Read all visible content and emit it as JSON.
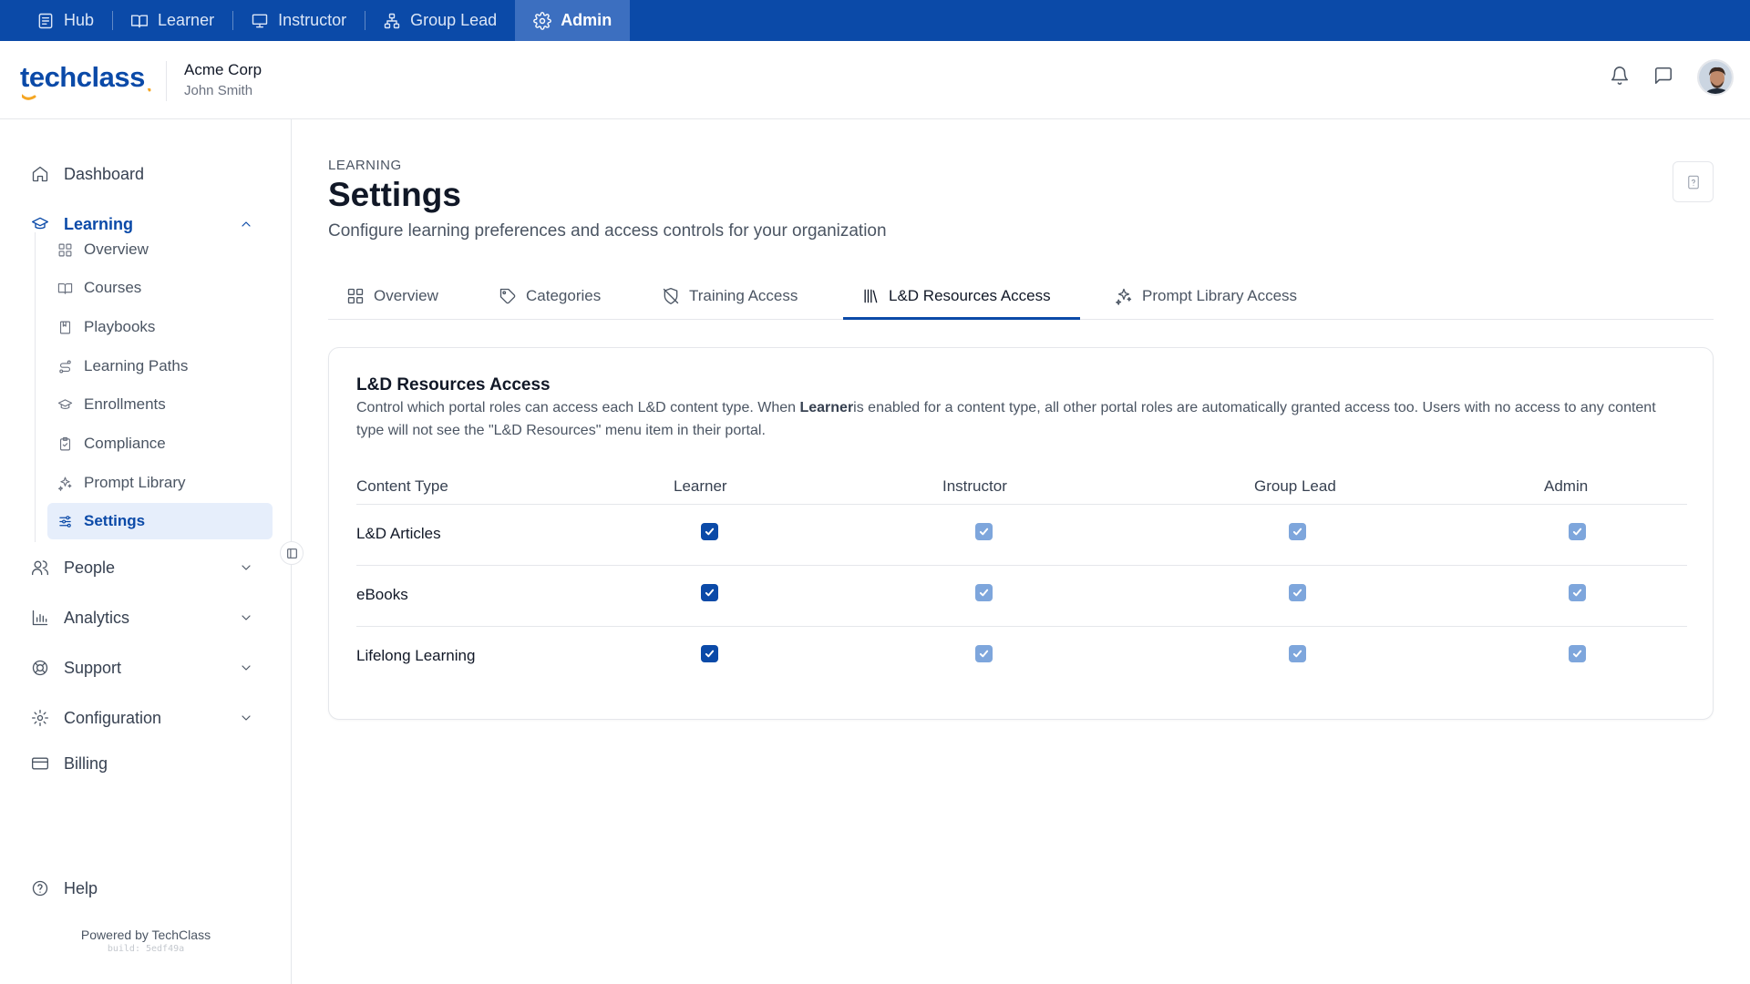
{
  "roles": [
    {
      "label": "Hub",
      "icon": "hub-icon"
    },
    {
      "label": "Learner",
      "icon": "book-open-icon"
    },
    {
      "label": "Instructor",
      "icon": "presentation-icon"
    },
    {
      "label": "Group Lead",
      "icon": "org-chart-icon"
    },
    {
      "label": "Admin",
      "icon": "gear-icon",
      "active": true
    }
  ],
  "header": {
    "logo": "techclass",
    "org_name": "Acme Corp",
    "user_name": "John Smith"
  },
  "sidebar": {
    "items": [
      {
        "label": "Dashboard",
        "icon": "home-icon"
      },
      {
        "label": "Learning",
        "icon": "graduation-cap-icon",
        "expanded": true
      },
      {
        "label": "People",
        "icon": "users-icon"
      },
      {
        "label": "Analytics",
        "icon": "bar-chart-icon"
      },
      {
        "label": "Support",
        "icon": "lifebuoy-icon"
      },
      {
        "label": "Configuration",
        "icon": "gear-icon"
      },
      {
        "label": "Billing",
        "icon": "credit-card-icon"
      }
    ],
    "learning_sub": [
      {
        "label": "Overview",
        "icon": "grid-icon"
      },
      {
        "label": "Courses",
        "icon": "book-open-icon"
      },
      {
        "label": "Playbooks",
        "icon": "bookmark-icon"
      },
      {
        "label": "Learning Paths",
        "icon": "route-icon"
      },
      {
        "label": "Enrollments",
        "icon": "graduation-cap-icon"
      },
      {
        "label": "Compliance",
        "icon": "clipboard-check-icon"
      },
      {
        "label": "Prompt Library",
        "icon": "sparkles-icon"
      },
      {
        "label": "Settings",
        "icon": "sliders-icon",
        "active": true
      }
    ],
    "help": "Help",
    "powered_by": "Powered by TechClass",
    "build": "build: 5edf49a"
  },
  "page": {
    "breadcrumb": "LEARNING",
    "title": "Settings",
    "subtitle": "Configure learning preferences and access controls for your organization"
  },
  "tabs": [
    {
      "label": "Overview",
      "icon": "grid-icon"
    },
    {
      "label": "Categories",
      "icon": "tag-icon"
    },
    {
      "label": "Training Access",
      "icon": "shield-off-icon"
    },
    {
      "label": "L&D Resources Access",
      "icon": "library-icon",
      "active": true
    },
    {
      "label": "Prompt Library Access",
      "icon": "sparkles-icon"
    }
  ],
  "card": {
    "title": "L&D Resources Access",
    "desc_part1": "Control which portal roles can access each L&D content type. When ",
    "desc_bold": "Learner",
    "desc_part2": "is enabled for a content type, all other portal roles are automatically granted access too. Users with no access to any content type will not see the \"L&D Resources\" menu item in their portal.",
    "columns": [
      "Content Type",
      "Learner",
      "Instructor",
      "Group Lead",
      "Admin"
    ],
    "rows": [
      {
        "label": "L&D Articles",
        "learner": true,
        "instructor": true,
        "group_lead": true,
        "admin": true
      },
      {
        "label": "eBooks",
        "learner": true,
        "instructor": true,
        "group_lead": true,
        "admin": true
      },
      {
        "label": "Lifelong Learning",
        "learner": true,
        "instructor": true,
        "group_lead": true,
        "admin": true
      }
    ]
  },
  "colors": {
    "brand": "#0b4aa8",
    "accent_orange": "#f5a623",
    "checkbox_disabled": "#7ea6dc"
  }
}
